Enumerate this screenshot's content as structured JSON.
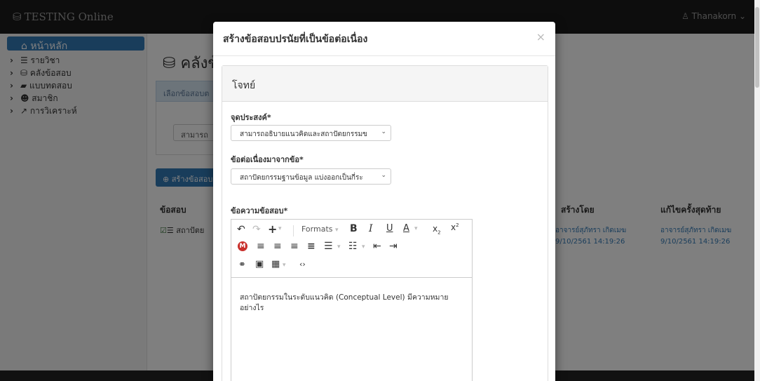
{
  "app": {
    "brand": "TESTING Online",
    "user": "Thanakorn"
  },
  "sidebar": {
    "home": "หน้าหลัก",
    "items": [
      {
        "label": "รายวิชา"
      },
      {
        "label": "คลังข้อสอบ"
      },
      {
        "label": "แบบทดสอบ"
      },
      {
        "label": "สมาชิก"
      },
      {
        "label": "การวิเคราะห์"
      }
    ]
  },
  "main": {
    "title": "คลังข้",
    "panel_heading": "เลือกข้อสอบต",
    "select_value": "สามารถ",
    "create_button": "สร้างข้อสอบ",
    "table": {
      "col_question": "ข้อสอบ",
      "col_created_by": "สร้างโดย",
      "col_updated": "แก้ไขครั้งสุดท้าย",
      "row_question": "สถาปัตย",
      "row_created_by": "อาจารย์สุภัทรา เกิดเมฆ",
      "row_created_at": "9/10/2561 14:19:26",
      "row_updated_by": "อาจารย์สุภัทรา เกิดเมฆ",
      "row_updated_at": "9/10/2561 14:19:26"
    }
  },
  "modal": {
    "title": "สร้างข้อสอบปรนัยที่เป็นข้อต่อเนื่อง",
    "close": "×",
    "panel_heading": "โจทย์",
    "objective_label": "จุดประสงค์*",
    "objective_value": "สามารถอธิบายแนวคิดและสถาปัตยกรรมข",
    "continues_label": "ข้อต่อเนื่องมาจากข้อ*",
    "continues_value": "สถาปัตยกรรมฐานข้อมูล แบ่งออกเป็นกี่ระ",
    "question_label": "ข้อความข้อสอบ*",
    "editor": {
      "formats": "Formats",
      "content": "สถาปัตยกรรมในระดับแนวคิด (Conceptual Level) มีความหมายอย่างไร"
    }
  }
}
